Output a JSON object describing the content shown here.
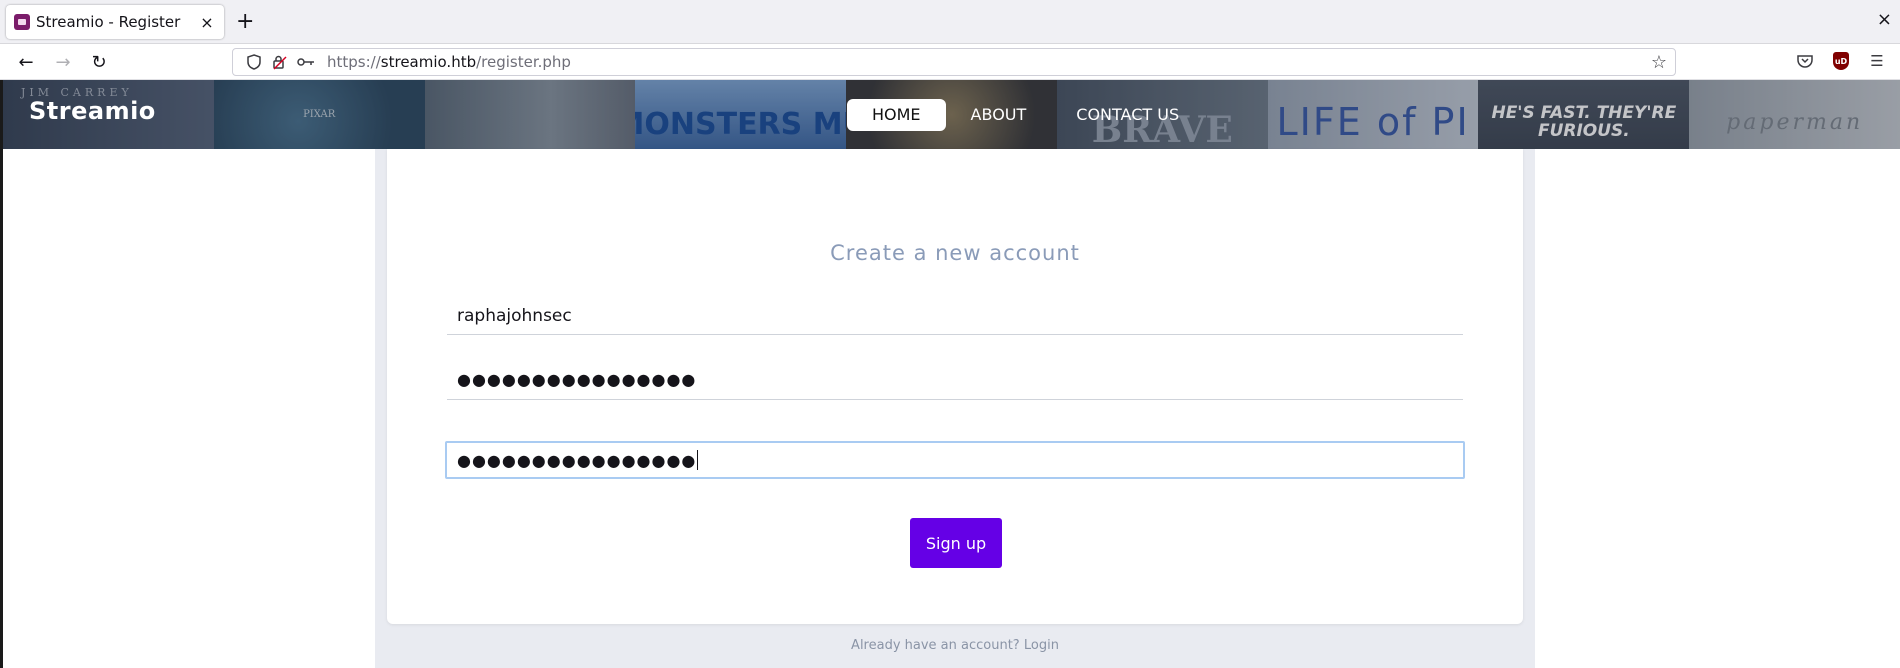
{
  "browser": {
    "tab_title": "Streamio - Register",
    "tab_close": "×",
    "new_tab": "+",
    "window_close": "×",
    "url_prefix": "https://",
    "url_host": "streamio.htb",
    "url_path": "/register.php"
  },
  "header": {
    "brand": "Streamio",
    "nav": [
      {
        "label": "HOME",
        "active": true
      },
      {
        "label": "ABOUT",
        "active": false
      },
      {
        "label": "CONTACT US",
        "active": false
      }
    ],
    "posters": [
      "JIM CARREY",
      "PIXAR",
      "",
      "MONSTERS MU",
      "",
      "BRAVE",
      "LIFE of PI",
      "HE'S FAST. THEY'RE FURIOUS.",
      "paperman"
    ]
  },
  "form": {
    "title": "Create a new account",
    "username_value": "raphajohnsec",
    "password_value": "●●●●●●●●●●●●●●●●",
    "confirm_value": "●●●●●●●●●●●●●●●●",
    "signup_label": "Sign up"
  },
  "footer": {
    "already_text": "Already have an account?",
    "login_link": "Login"
  },
  "colors": {
    "accent": "#6500e6",
    "title": "#8a9bb8",
    "focus_ring": "#a9cbf2",
    "page_bg": "#e9ebf1"
  }
}
